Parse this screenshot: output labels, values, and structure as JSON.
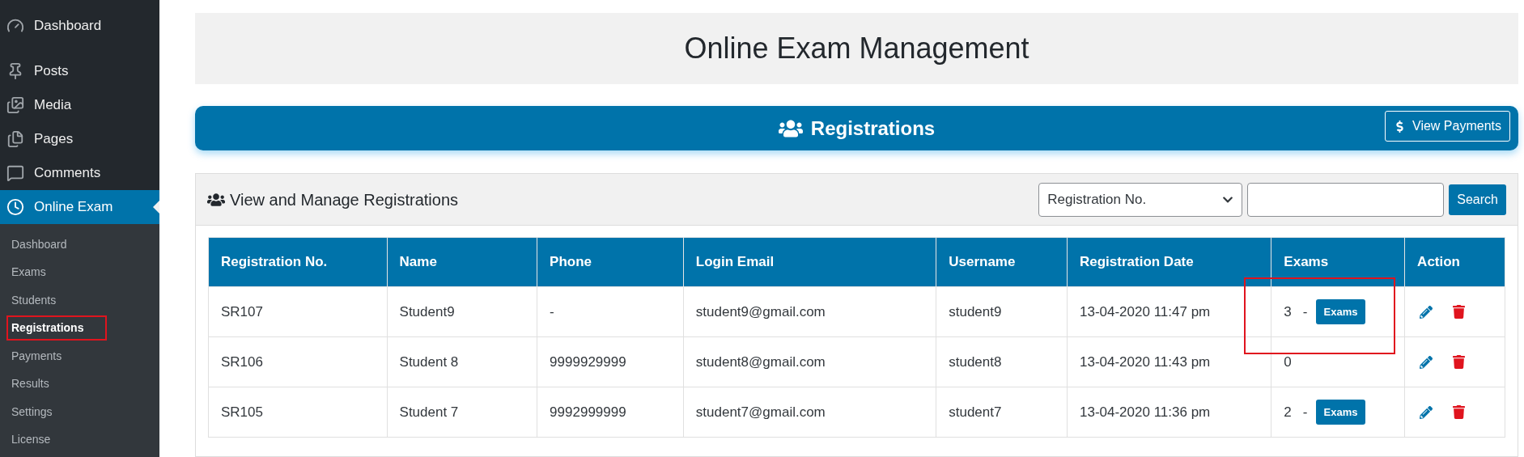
{
  "sidebar": {
    "menu": [
      {
        "label": "Dashboard",
        "selected": false
      },
      {
        "label": "Posts",
        "selected": false
      },
      {
        "label": "Media",
        "selected": false
      },
      {
        "label": "Pages",
        "selected": false
      },
      {
        "label": "Comments",
        "selected": false
      },
      {
        "label": "Online Exam",
        "selected": true
      }
    ],
    "submenu": [
      {
        "label": "Dashboard",
        "selected": false,
        "highlighted": false
      },
      {
        "label": "Exams",
        "selected": false,
        "highlighted": false
      },
      {
        "label": "Students",
        "selected": false,
        "highlighted": false
      },
      {
        "label": "Registrations",
        "selected": true,
        "highlighted": true
      },
      {
        "label": "Payments",
        "selected": false,
        "highlighted": false
      },
      {
        "label": "Results",
        "selected": false,
        "highlighted": false
      },
      {
        "label": "Settings",
        "selected": false,
        "highlighted": false
      },
      {
        "label": "License",
        "selected": false,
        "highlighted": false
      }
    ]
  },
  "page_title": "Online Exam Management",
  "banner": {
    "title": "Registrations",
    "button": "View Payments"
  },
  "panel": {
    "title": "View and Manage Registrations",
    "filter_select": "Registration No.",
    "search_button": "Search"
  },
  "table": {
    "columns": [
      "Registration No.",
      "Name",
      "Phone",
      "Login Email",
      "Username",
      "Registration Date",
      "Exams",
      "Action"
    ],
    "rows": [
      {
        "registration_no": "SR107",
        "name": "Student9",
        "phone": "-",
        "login_email": "student9@gmail.com",
        "username": "student9",
        "registration_date": "13-04-2020 11:47 pm",
        "exams_count": "3",
        "separator": "-",
        "exams_button": "Exams",
        "highlighted": true
      },
      {
        "registration_no": "SR106",
        "name": "Student 8",
        "phone": "9999929999",
        "login_email": "student8@gmail.com",
        "username": "student8",
        "registration_date": "13-04-2020 11:43 pm",
        "exams_count": "0",
        "highlighted": false
      },
      {
        "registration_no": "SR105",
        "name": "Student 7",
        "phone": "9992999999",
        "login_email": "student7@gmail.com",
        "username": "student7",
        "registration_date": "13-04-2020 11:36 pm",
        "exams_count": "2",
        "separator": "-",
        "exams_button": "Exams",
        "highlighted": false
      }
    ]
  }
}
